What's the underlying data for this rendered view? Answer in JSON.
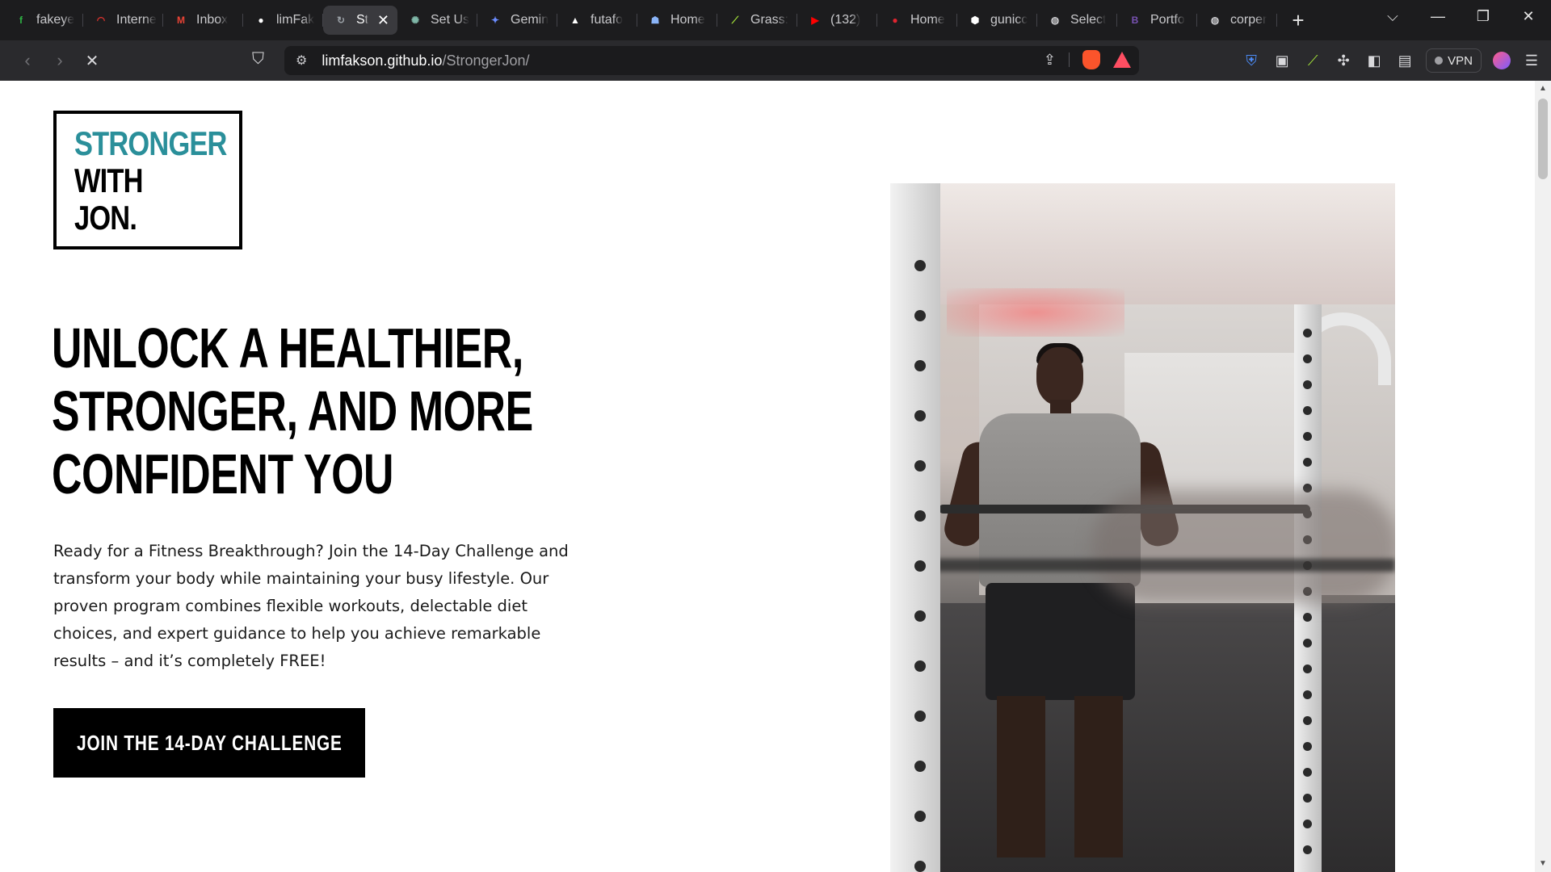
{
  "browser": {
    "tabs": [
      {
        "title": "fakeye",
        "icon": "fakeye-icon",
        "color": "#2fb344",
        "glyph": "f"
      },
      {
        "title": "Interne",
        "icon": "internet-speed-icon",
        "color": "#e0342f",
        "glyph": "◠"
      },
      {
        "title": "Inbox",
        "icon": "gmail-icon",
        "color": "#ea4335",
        "glyph": "M"
      },
      {
        "title": "limFak",
        "icon": "github-icon",
        "color": "#ffffff",
        "glyph": "●"
      },
      {
        "title": "St",
        "icon": "site-icon",
        "color": "#9aa0a6",
        "glyph": "↻",
        "active": true
      },
      {
        "title": "Set Us",
        "icon": "chatgpt-icon",
        "color": "#7fb7a8",
        "glyph": "✺"
      },
      {
        "title": "Gemin",
        "icon": "gemini-icon",
        "color": "#6b8cff",
        "glyph": "✦"
      },
      {
        "title": "futafo",
        "icon": "futafo-icon",
        "color": "#ffffff",
        "glyph": "▲"
      },
      {
        "title": "Home",
        "icon": "home-app-icon",
        "color": "#8ab4f8",
        "glyph": "☗"
      },
      {
        "title": "Grass:",
        "icon": "grass-icon",
        "color": "#a7e83a",
        "glyph": "⟋"
      },
      {
        "title": "(132)",
        "icon": "youtube-icon",
        "color": "#ff0000",
        "glyph": "▶"
      },
      {
        "title": "Home",
        "icon": "home-red-icon",
        "color": "#e0242f",
        "glyph": "●"
      },
      {
        "title": "gunicc",
        "icon": "gunicorn-icon",
        "color": "#ffffff",
        "glyph": "⬢"
      },
      {
        "title": "Select",
        "icon": "globe-icon",
        "color": "#c9c9cc",
        "glyph": "◍"
      },
      {
        "title": "Portfo",
        "icon": "bootstrap-icon",
        "color": "#7952b3",
        "glyph": "B"
      },
      {
        "title": "corper",
        "icon": "globe-icon",
        "color": "#c9c9cc",
        "glyph": "◍"
      }
    ],
    "active_tab_close": "✕",
    "new_tab": "+",
    "window": {
      "dropdown": "⌵",
      "minimize": "—",
      "restore": "❐",
      "close": "✕"
    },
    "nav": {
      "back": "‹",
      "forward": "›",
      "reload": "✕"
    },
    "bookmark_icon": "⛉",
    "url_host": "limfakson.github.io",
    "url_path": "/StrongerJon/",
    "vpn_label": "VPN"
  },
  "page": {
    "logo": {
      "line1": "STRONGER",
      "line2": "WITH",
      "line3": "JON."
    },
    "headline": [
      "UNLOCK A HEALTHIER,",
      "STRONGER, AND MORE",
      "CONFIDENT YOU"
    ],
    "intro": "Ready for a Fitness Breakthrough? Join the 14-Day Challenge and transform your body while maintaining your busy lifestyle. Our proven program combines flexible workouts, delectable diet choices, and expert guidance to help you achieve remarkable results – and it’s completely FREE!",
    "cta_label": "JOIN THE 14-DAY CHALLENGE",
    "accent_color": "#2a8f9a"
  }
}
